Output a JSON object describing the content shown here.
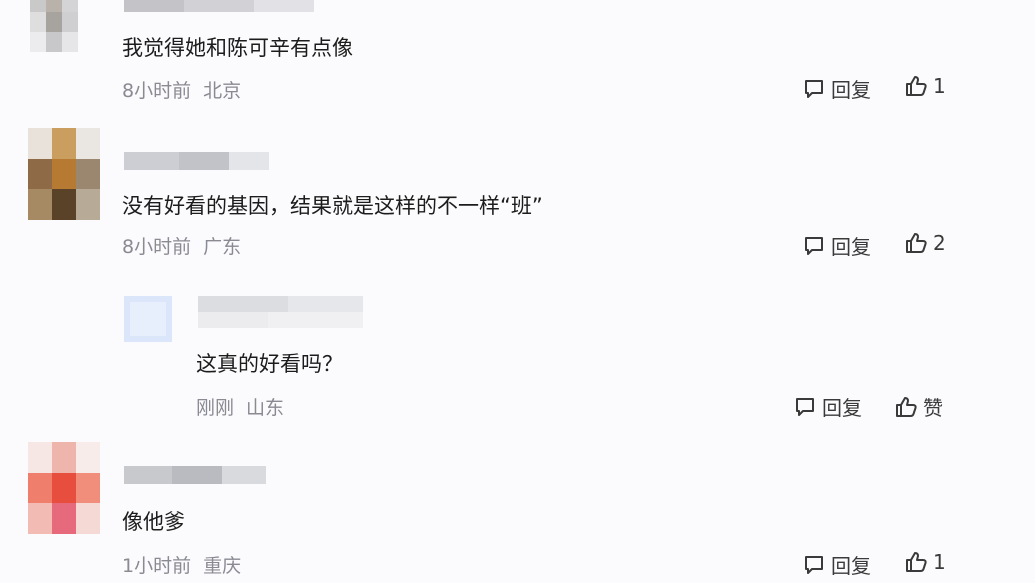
{
  "comments": [
    {
      "text": "我觉得她和陈可辛有点像",
      "time": "8小时前",
      "location": "北京",
      "reply_label": "回复",
      "like_count": "1"
    },
    {
      "text": "没有好看的基因，结果就是这样的不一样“班”",
      "time": "8小时前",
      "location": "广东",
      "reply_label": "回复",
      "like_count": "2"
    },
    {
      "text": "这真的好看吗？",
      "time": "刚刚",
      "location": "山东",
      "reply_label": "回复",
      "like_count": "赞"
    },
    {
      "text": "像他爹",
      "time": "1小时前",
      "location": "重庆",
      "reply_label": "回复",
      "like_count": "1"
    }
  ],
  "icons": {
    "reply": "comment-bubble-icon",
    "like": "thumbs-up-icon"
  },
  "colors": {
    "background": "#fbfbfd",
    "text": "#1c1c1c",
    "meta": "#8a8a92"
  }
}
